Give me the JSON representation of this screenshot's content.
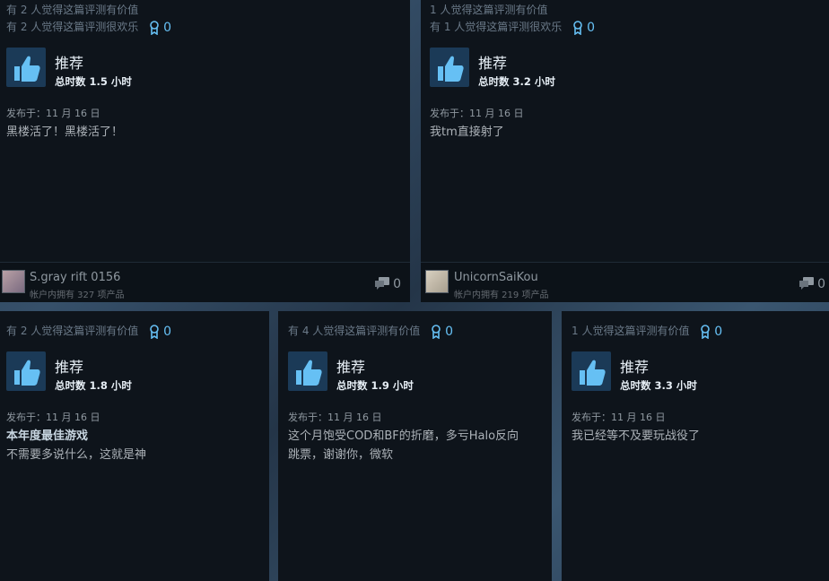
{
  "reviews": [
    {
      "helpful": "有 2 人觉得这篇评测有价值",
      "funny": "有 2 人觉得这篇评测很欢乐",
      "awards": "0",
      "verdict": "推荐",
      "hours": "总时数 1.5 小时",
      "posted": "发布于：11 月 16 日",
      "text": "黑楼活了！黑楼活了！",
      "username": "S.gray rift 0156",
      "owned": "帐户内拥有 327 项产品",
      "comments": "0"
    },
    {
      "helpful": "1 人觉得这篇评测有价值",
      "funny": "有 1 人觉得这篇评测很欢乐",
      "awards": "0",
      "verdict": "推荐",
      "hours": "总时数 3.2 小时",
      "posted": "发布于：11 月 16 日",
      "text": "我tm直接射了",
      "username": "UnicornSaiKou",
      "owned": "帐户内拥有 219 项产品",
      "comments": "0"
    },
    {
      "helpful": "有 2 人觉得这篇评测有价值",
      "awards": "0",
      "verdict": "推荐",
      "hours": "总时数 1.8 小时",
      "posted": "发布于：11 月 16 日",
      "text_bold": "本年度最佳游戏",
      "text": "不需要多说什么，这就是神"
    },
    {
      "helpful": "有 4 人觉得这篇评测有价值",
      "awards": "0",
      "verdict": "推荐",
      "hours": "总时数 1.9 小时",
      "posted": "发布于：11 月 16 日",
      "text_line1": "这个月饱受COD和BF的折磨，多亏Halo反向",
      "text_line2": "跳票，谢谢你，微软"
    },
    {
      "helpful": "1 人觉得这篇评测有价值",
      "awards": "0",
      "verdict": "推荐",
      "hours": "总时数 3.3 小时",
      "posted": "发布于：11 月 16 日",
      "text": "我已经等不及要玩战役了"
    }
  ],
  "icons": {
    "thumb": "thumbs-up-icon",
    "award": "award-icon",
    "comment": "comment-icon"
  },
  "colors": {
    "card_bg": "#0e141b",
    "accent": "#66c0f4",
    "thumb_bg": "#1b3a57"
  }
}
